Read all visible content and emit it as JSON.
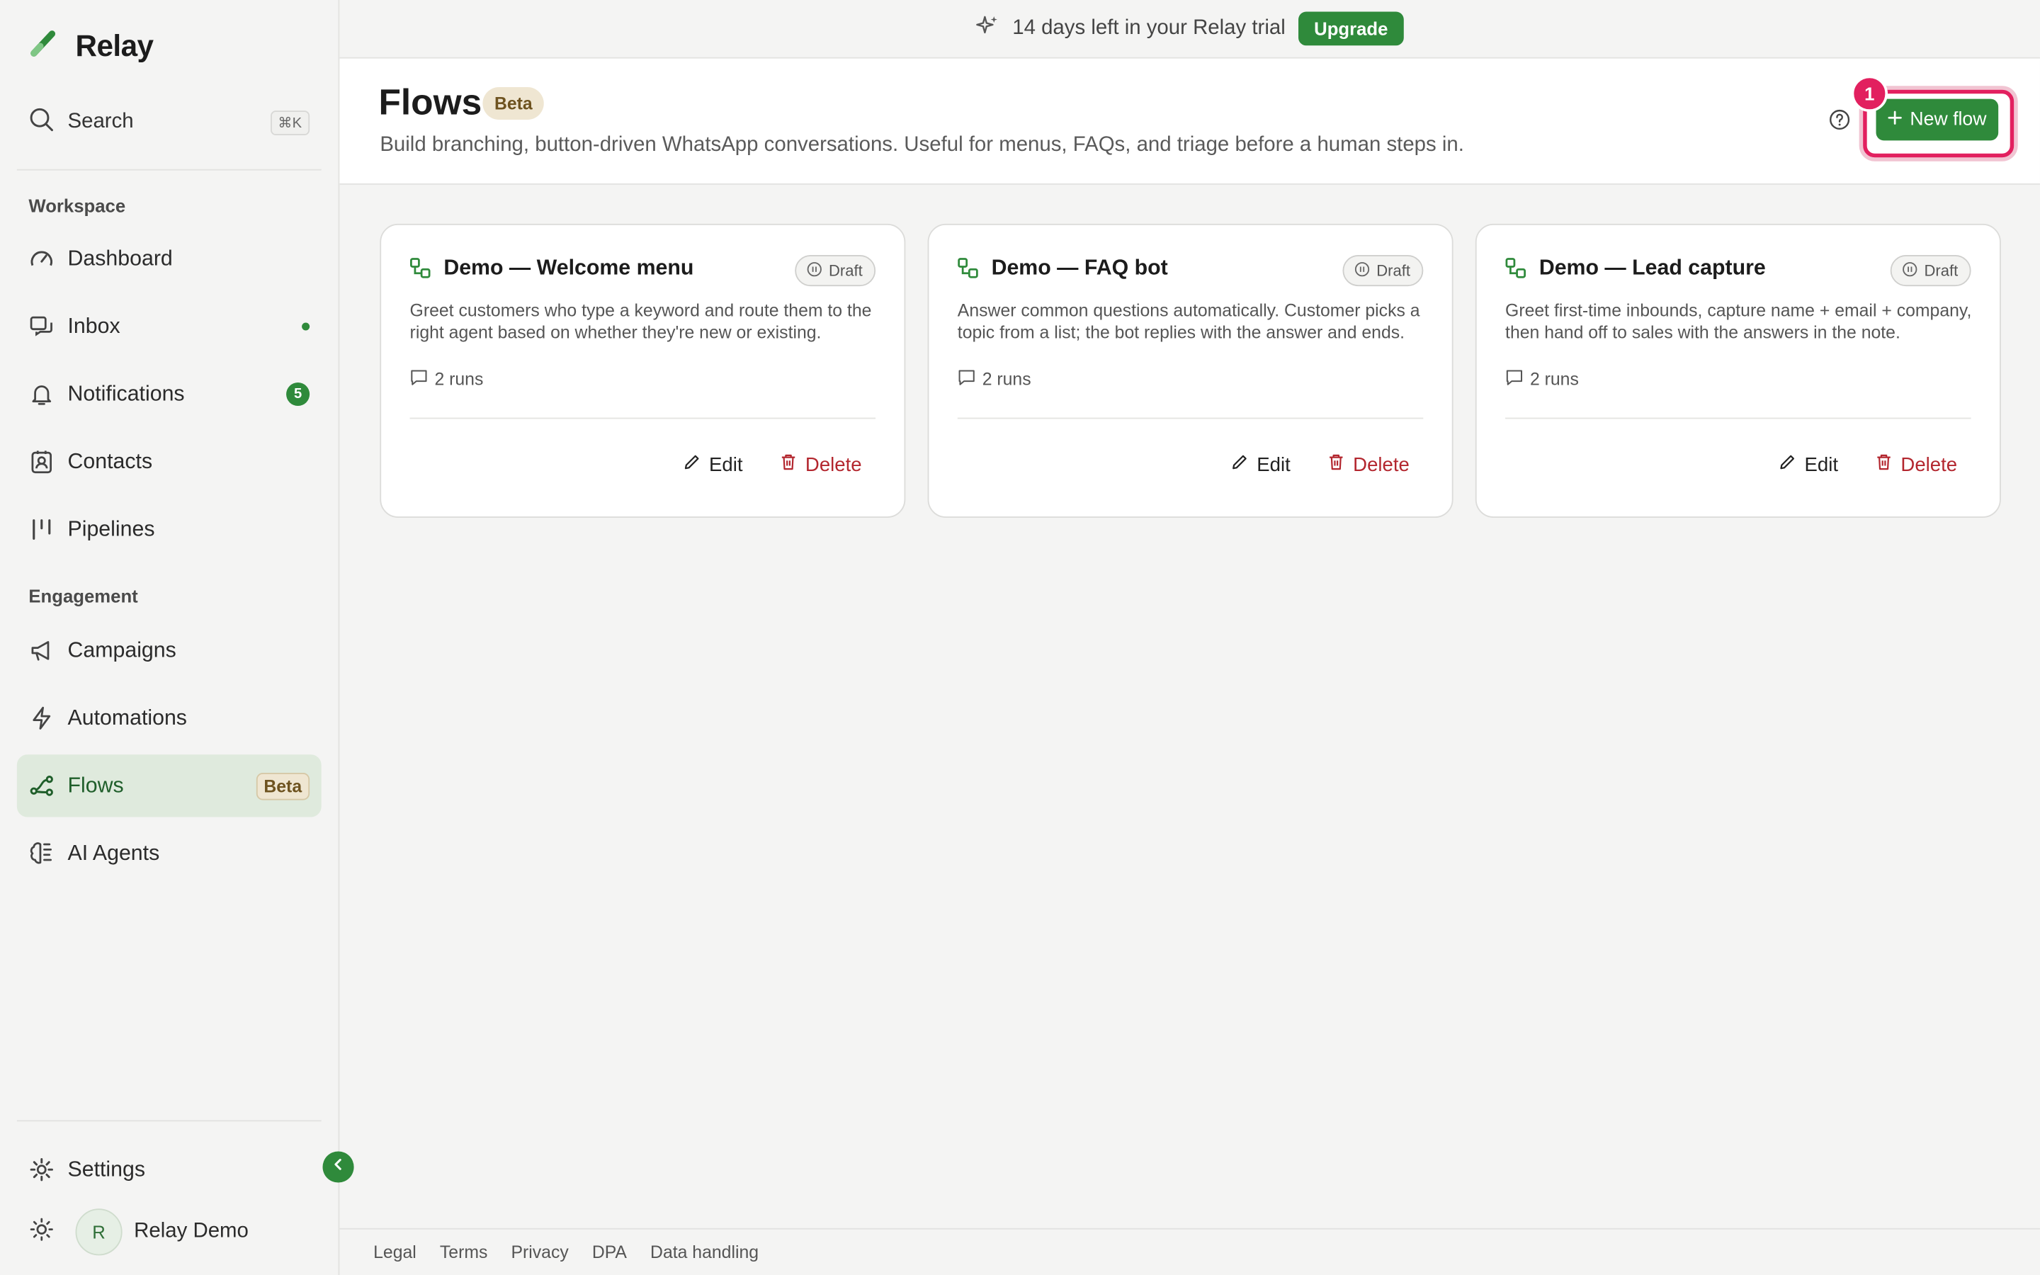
{
  "app": {
    "name": "Relay"
  },
  "sidebar": {
    "search_label": "Search",
    "search_shortcut": "⌘K",
    "sections": {
      "workspace": "Workspace",
      "engagement": "Engagement"
    },
    "items": [
      {
        "label": "Dashboard",
        "icon": "gauge-icon"
      },
      {
        "label": "Inbox",
        "icon": "inbox-icon",
        "unread_dot": true
      },
      {
        "label": "Notifications",
        "icon": "bell-icon",
        "count": "5"
      },
      {
        "label": "Contacts",
        "icon": "contacts-icon"
      },
      {
        "label": "Pipelines",
        "icon": "pipelines-icon"
      },
      {
        "label": "Campaigns",
        "icon": "megaphone-icon"
      },
      {
        "label": "Automations",
        "icon": "lightning-icon"
      },
      {
        "label": "Flows",
        "icon": "flow-icon",
        "badge": "Beta",
        "active": true
      },
      {
        "label": "AI Agents",
        "icon": "brain-icon"
      }
    ],
    "settings_label": "Settings",
    "user": {
      "initial": "R",
      "name": "Relay Demo"
    }
  },
  "banner": {
    "trial_text": "14 days left in your Relay trial",
    "upgrade_label": "Upgrade"
  },
  "header": {
    "title": "Flows",
    "beta_label": "Beta",
    "subtitle": "Build branching, button-driven WhatsApp conversations. Useful for menus, FAQs, and triage before a human steps in.",
    "new_flow_label": "New flow",
    "highlight_badge": "1"
  },
  "flows": [
    {
      "name": "Demo — Welcome menu",
      "status": "Draft",
      "description": "Greet customers who type a keyword and route them to the right agent based on whether they're new or existing.",
      "runs": "2 runs"
    },
    {
      "name": "Demo — FAQ bot",
      "status": "Draft",
      "description": "Answer common questions automatically. Customer picks a topic from a list; the bot replies with the answer and ends.",
      "runs": "2 runs"
    },
    {
      "name": "Demo — Lead capture",
      "status": "Draft",
      "description": "Greet first-time inbounds, capture name + email + company, then hand off to sales with the answers in the note.",
      "runs": "2 runs"
    }
  ],
  "card_actions": {
    "edit_label": "Edit",
    "delete_label": "Delete"
  },
  "footer": {
    "links": [
      "Legal",
      "Terms",
      "Privacy",
      "DPA",
      "Data handling"
    ]
  },
  "colors": {
    "brand_green": "#2f8a3b",
    "highlight_pink": "#e2205f",
    "danger": "#b3262e"
  }
}
